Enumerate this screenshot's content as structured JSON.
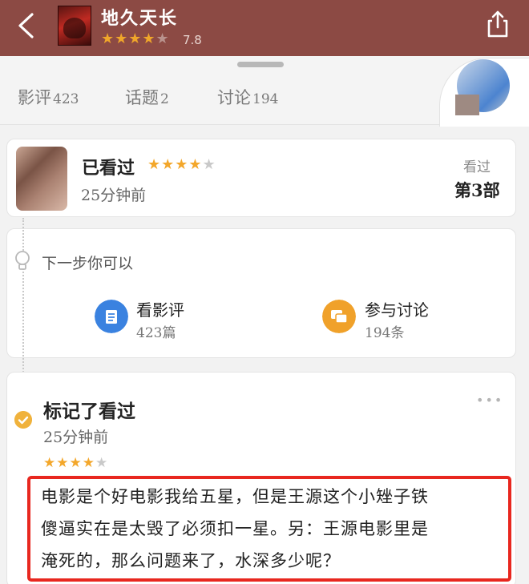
{
  "header": {
    "title": "地久天长",
    "rating_score": "7.8",
    "rating_stars": 4
  },
  "tabs": [
    {
      "label": "影评",
      "count": "423"
    },
    {
      "label": "话题",
      "count": "2"
    },
    {
      "label": "讨论",
      "count": "194"
    }
  ],
  "status_card": {
    "status": "已看过",
    "stars": 4,
    "time_ago": "25分钟前",
    "seen_label": "看过",
    "seen_count": "第3部"
  },
  "next_steps": {
    "title": "下一步你可以",
    "actions": [
      {
        "title": "看影评",
        "sub": "423篇",
        "icon": "list-icon",
        "color": "#3a82e0"
      },
      {
        "title": "参与讨论",
        "sub": "194条",
        "icon": "chat-icon",
        "color": "#f0a12a"
      }
    ]
  },
  "activity": {
    "title": "标记了看过",
    "time_ago": "25分钟前",
    "stars": 4,
    "more": "•••",
    "review_lines": [
      "电影是个好电影我给五星，但是王源这个小矬子铁",
      "傻逼实在是太毁了必须扣一星。另：王源电影里是",
      "淹死的，那么问题来了，水深多少呢？"
    ]
  },
  "colors": {
    "header_bg": "#8c4a44",
    "star": "#f3a72b",
    "highlight": "#e8271f"
  }
}
